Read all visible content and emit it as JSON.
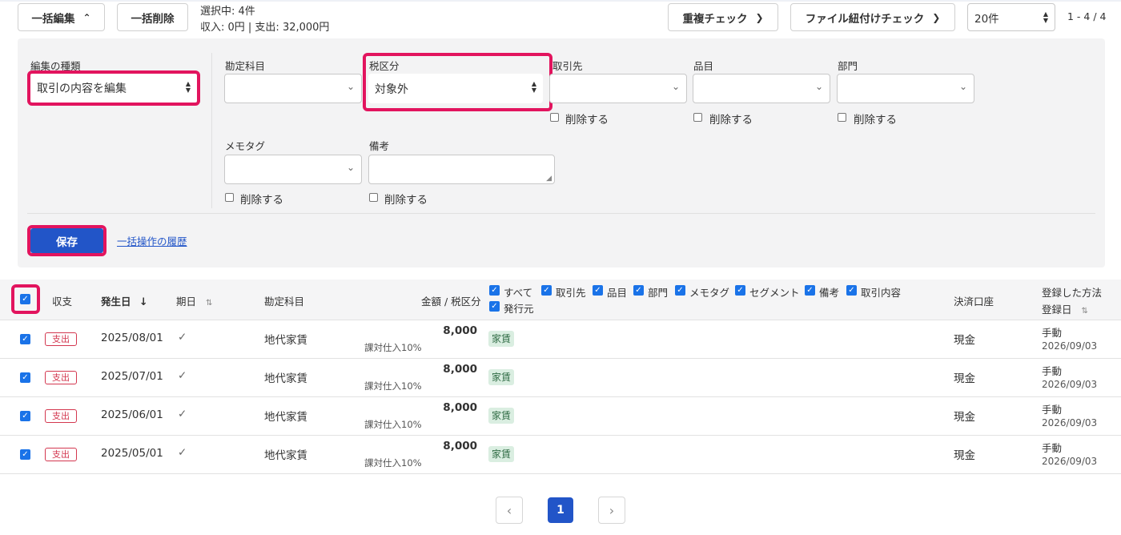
{
  "toolbar": {
    "bulk_edit": "一括編集",
    "bulk_delete": "一括削除",
    "selected_count": "選択中: 4件",
    "income_expense": "収入: 0円 | 支出: 32,000円",
    "duplicate_check": "重複チェック",
    "file_link_check": "ファイル紐付けチェック",
    "page_size": "20件",
    "range": "1 - 4 / 4"
  },
  "edit_panel": {
    "edit_type_label": "編集の種類",
    "edit_type_value": "取引の内容を編集",
    "account_label": "勘定科目",
    "account_value": "",
    "tax_label": "税区分",
    "tax_value": "対象外",
    "partner_label": "取引先",
    "item_label": "品目",
    "section_label": "部門",
    "memo_tag_label": "メモタグ",
    "note_label": "備考",
    "delete_label": "削除する",
    "save": "保存",
    "history_link": "一括操作の履歴"
  },
  "table": {
    "headers": {
      "income_expense": "収支",
      "date": "発生日",
      "period": "期日",
      "account": "勘定科目",
      "amount_tax": "金額 / 税区分",
      "filters": [
        "すべて",
        "取引先",
        "品目",
        "部門",
        "メモタグ",
        "セグメント",
        "備考",
        "取引内容",
        "発行元"
      ],
      "payment": "決済口座",
      "reg_method": "登録した方法",
      "reg_date": "登録日"
    },
    "rows": [
      {
        "type": "支出",
        "date": "2025/08/01",
        "account": "地代家賃",
        "amount": "8,000",
        "tax": "課対仕入10%",
        "tag": "家賃",
        "payment": "現金",
        "method": "手動",
        "reg_date": "2026/09/03"
      },
      {
        "type": "支出",
        "date": "2025/07/01",
        "account": "地代家賃",
        "amount": "8,000",
        "tax": "課対仕入10%",
        "tag": "家賃",
        "payment": "現金",
        "method": "手動",
        "reg_date": "2026/09/03"
      },
      {
        "type": "支出",
        "date": "2025/06/01",
        "account": "地代家賃",
        "amount": "8,000",
        "tax": "課対仕入10%",
        "tag": "家賃",
        "payment": "現金",
        "method": "手動",
        "reg_date": "2026/09/03"
      },
      {
        "type": "支出",
        "date": "2025/05/01",
        "account": "地代家賃",
        "amount": "8,000",
        "tax": "課対仕入10%",
        "tag": "家賃",
        "payment": "現金",
        "method": "手動",
        "reg_date": "2026/09/03"
      }
    ]
  },
  "pagination": {
    "current": "1"
  },
  "colors": {
    "accent": "#2255c8",
    "highlight": "#e2145e",
    "expense": "#d3374f",
    "tag_bg": "#daeee1"
  }
}
